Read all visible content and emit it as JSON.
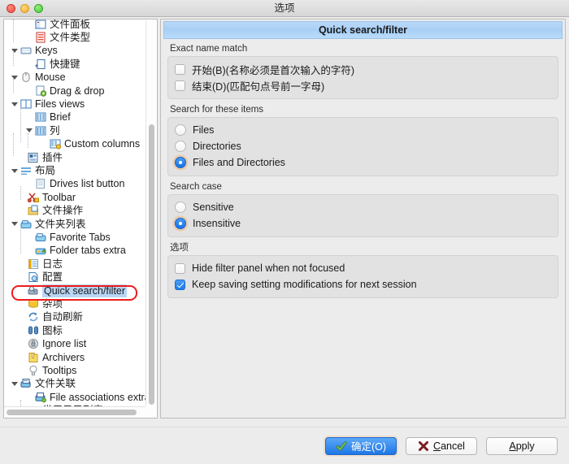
{
  "window": {
    "title": "选项",
    "controls": {
      "close": "close-button",
      "minimize": "minimize-button",
      "maximize": "maximize-button"
    }
  },
  "sidebar": {
    "items": [
      {
        "label": "文件面板",
        "indent": 2,
        "twisty": "none",
        "icon": "file-panel-icon",
        "selected": false
      },
      {
        "label": "文件类型",
        "indent": 2,
        "twisty": "none",
        "icon": "file-types-icon",
        "selected": false
      },
      {
        "label": "Keys",
        "indent": 0,
        "twisty": "open",
        "icon": "keys-icon",
        "selected": false
      },
      {
        "label": "快捷键",
        "indent": 2,
        "twisty": "none",
        "icon": "hotkeys-icon",
        "selected": false
      },
      {
        "label": "Mouse",
        "indent": 0,
        "twisty": "open",
        "icon": "mouse-icon",
        "selected": false
      },
      {
        "label": "Drag & drop",
        "indent": 2,
        "twisty": "none",
        "icon": "drag-drop-icon",
        "selected": false
      },
      {
        "label": "Files views",
        "indent": 0,
        "twisty": "open",
        "icon": "files-views-icon",
        "selected": false
      },
      {
        "label": "Brief",
        "indent": 2,
        "twisty": "none",
        "icon": "brief-icon",
        "selected": false
      },
      {
        "label": "列",
        "indent": 2,
        "twisty": "open",
        "icon": "columns-icon",
        "selected": false
      },
      {
        "label": "Custom columns",
        "indent": 4,
        "twisty": "none",
        "icon": "custom-columns-icon",
        "selected": false
      },
      {
        "label": "插件",
        "indent": 1,
        "twisty": "none",
        "icon": "plugins-icon",
        "selected": false
      },
      {
        "label": "布局",
        "indent": 0,
        "twisty": "open",
        "icon": "layout-icon",
        "selected": false
      },
      {
        "label": "Drives list button",
        "indent": 2,
        "twisty": "none",
        "icon": "drives-list-icon",
        "selected": false
      },
      {
        "label": "Toolbar",
        "indent": 1,
        "twisty": "none",
        "icon": "toolbar-icon",
        "selected": false
      },
      {
        "label": "文件操作",
        "indent": 1,
        "twisty": "none",
        "icon": "file-operations-icon",
        "selected": false
      },
      {
        "label": "文件夹列表",
        "indent": 0,
        "twisty": "open",
        "icon": "folder-tabs-icon",
        "selected": false
      },
      {
        "label": "Favorite Tabs",
        "indent": 2,
        "twisty": "none",
        "icon": "favorite-tabs-icon",
        "selected": false
      },
      {
        "label": "Folder tabs extra",
        "indent": 2,
        "twisty": "none",
        "icon": "folder-tabs-extra-icon",
        "selected": false
      },
      {
        "label": "日志",
        "indent": 1,
        "twisty": "none",
        "icon": "log-icon",
        "selected": false
      },
      {
        "label": "配置",
        "indent": 1,
        "twisty": "none",
        "icon": "configuration-icon",
        "selected": false
      },
      {
        "label": "Quick search/filter",
        "indent": 1,
        "twisty": "none",
        "icon": "quick-search-icon",
        "selected": true
      },
      {
        "label": "杂项",
        "indent": 1,
        "twisty": "none",
        "icon": "misc-icon",
        "selected": false
      },
      {
        "label": "自动刷新",
        "indent": 1,
        "twisty": "none",
        "icon": "auto-refresh-icon",
        "selected": false
      },
      {
        "label": "图标",
        "indent": 1,
        "twisty": "none",
        "icon": "icons-icon",
        "selected": false
      },
      {
        "label": "Ignore list",
        "indent": 1,
        "twisty": "none",
        "icon": "ignore-list-icon",
        "selected": false
      },
      {
        "label": "Archivers",
        "indent": 1,
        "twisty": "none",
        "icon": "archivers-icon",
        "selected": false
      },
      {
        "label": "Tooltips",
        "indent": 1,
        "twisty": "none",
        "icon": "tooltips-icon",
        "selected": false
      },
      {
        "label": "文件关联",
        "indent": 0,
        "twisty": "open",
        "icon": "file-assoc-icon",
        "selected": false
      },
      {
        "label": "File associations extra",
        "indent": 2,
        "twisty": "none",
        "icon": "file-assoc-extra-icon",
        "selected": false
      },
      {
        "label": "常用目录列表",
        "indent": 1,
        "twisty": "none",
        "icon": "dir-hotlist-icon",
        "selected": false
      }
    ]
  },
  "panel": {
    "header": "Quick search/filter",
    "groups": [
      {
        "title": "Exact name match",
        "kind": "checkbox",
        "options": [
          {
            "label": "开始(B)(名称必须是首次输入的字符)",
            "checked": false
          },
          {
            "label": "结束(D)(匹配句点号前一字母)",
            "checked": false
          }
        ]
      },
      {
        "title": "Search for these items",
        "kind": "radio",
        "options": [
          {
            "label": "Files",
            "checked": false
          },
          {
            "label": "Directories",
            "checked": false
          },
          {
            "label": "Files and Directories",
            "checked": true
          }
        ]
      },
      {
        "title": "Search case",
        "kind": "radio",
        "options": [
          {
            "label": "Sensitive",
            "checked": false
          },
          {
            "label": "Insensitive",
            "checked": true
          }
        ]
      },
      {
        "title": "选项",
        "kind": "checkbox",
        "options": [
          {
            "label": "Hide filter panel when not focused",
            "checked": false
          },
          {
            "label": "Keep saving setting modifications for next session",
            "checked": true
          }
        ]
      }
    ]
  },
  "footer": {
    "buttons": [
      {
        "label": "确定(O)",
        "icon": "ok-check-icon",
        "default": true
      },
      {
        "label": "Cancel",
        "icon": "cancel-x-icon",
        "default": false
      },
      {
        "label": "Apply",
        "icon": "none",
        "default": false
      }
    ]
  },
  "colors": {
    "accent_blue": "#1f76e6",
    "header_blue": "#b0d4f6",
    "selection_blue": "#b8d6f5",
    "annotation_red": "#ee1c1c",
    "group_bg": "#e2e2e2",
    "window_bg": "#ececec"
  }
}
